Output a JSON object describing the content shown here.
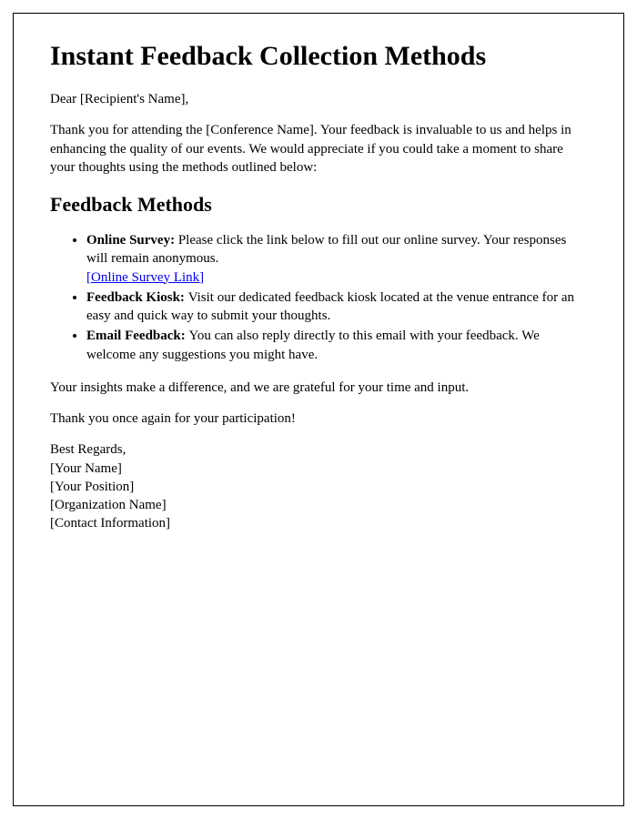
{
  "title": "Instant Feedback Collection Methods",
  "greeting": "Dear [Recipient's Name],",
  "intro": "Thank you for attending the [Conference Name]. Your feedback is invaluable to us and helps in enhancing the quality of our events. We would appreciate if you could take a moment to share your thoughts using the methods outlined below:",
  "section_heading": "Feedback Methods",
  "methods": {
    "item1": {
      "label": "Online Survey: ",
      "text": "Please click the link below to fill out our online survey. Your responses will remain anonymous.",
      "link_text": "[Online Survey Link]"
    },
    "item2": {
      "label": "Feedback Kiosk: ",
      "text": "Visit our dedicated feedback kiosk located at the venue entrance for an easy and quick way to submit your thoughts."
    },
    "item3": {
      "label": "Email Feedback: ",
      "text": "You can also reply directly to this email with your feedback. We welcome any suggestions you might have."
    }
  },
  "closing1": "Your insights make a difference, and we are grateful for your time and input.",
  "closing2": "Thank you once again for your participation!",
  "signature": {
    "line1": "Best Regards,",
    "line2": "[Your Name]",
    "line3": "[Your Position]",
    "line4": "[Organization Name]",
    "line5": "[Contact Information]"
  }
}
